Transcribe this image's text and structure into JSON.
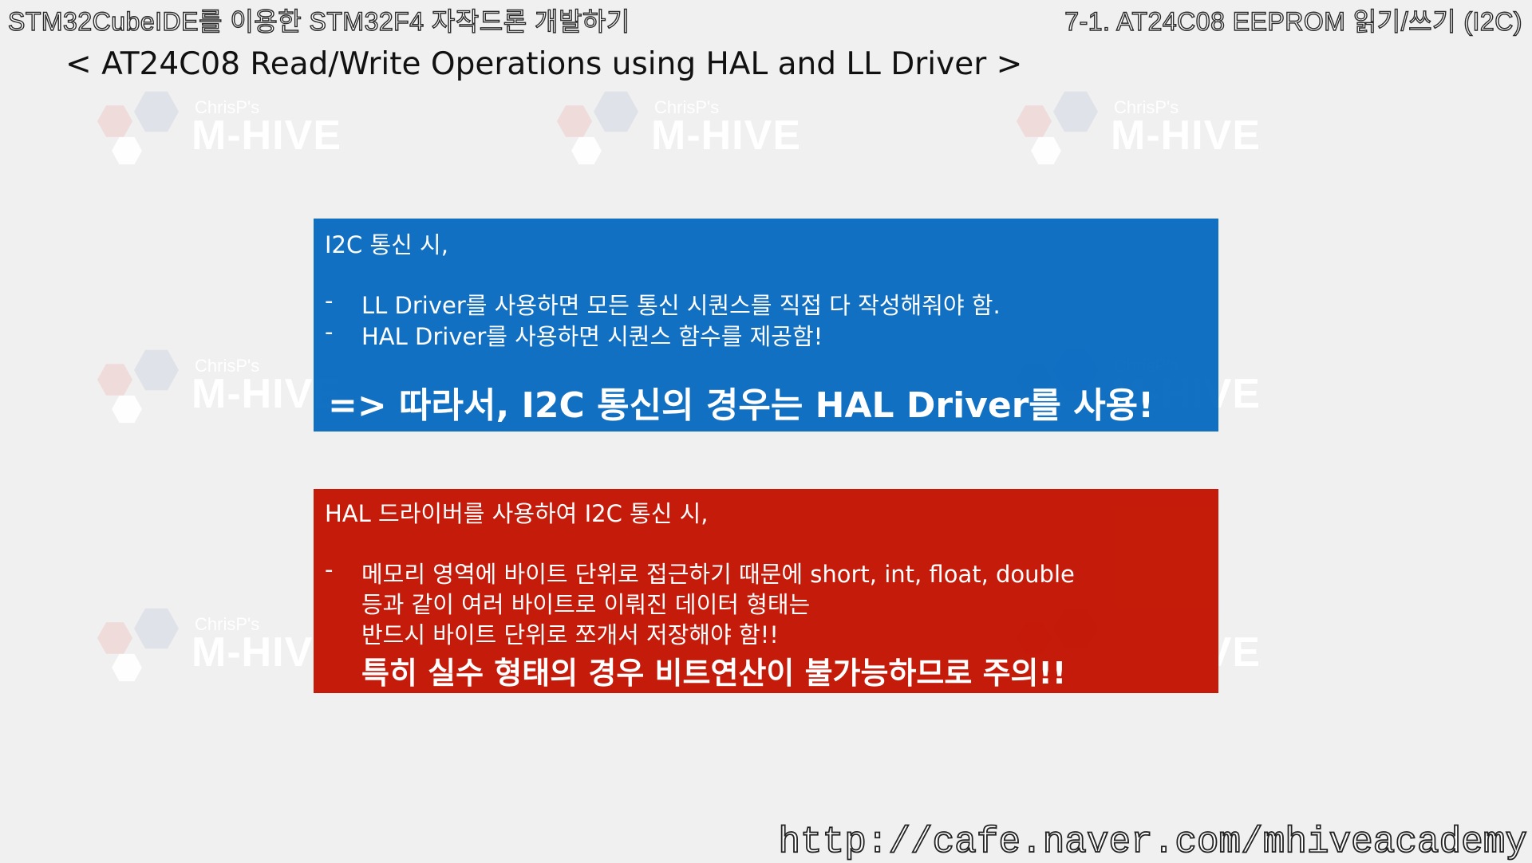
{
  "header": {
    "left_title": "STM32CubeIDE를 이용한 STM32F4 자작드론 개발하기",
    "right_title": "7-1. AT24C08 EEPROM 읽기/쓰기 (I2C)"
  },
  "subtitle": "< AT24C08 Read/Write Operations using HAL and LL Driver >",
  "watermark": {
    "small": "ChrisP's",
    "big": "M-HIVE"
  },
  "blue_box": {
    "heading": "I2C 통신 시,",
    "bullet_mark": "-",
    "bullets": [
      "LL Driver를 사용하면 모든 통신 시퀀스를 직접 다 작성해줘야 함.",
      "HAL Driver를 사용하면 시퀀스 함수를 제공함!"
    ],
    "conclusion": "=> 따라서, I2C 통신의 경우는 HAL Driver를 사용!"
  },
  "red_box": {
    "heading": "HAL 드라이버를 사용하여 I2C 통신 시,",
    "bullet_mark": "-",
    "bullet_lines": [
      "메모리 영역에 바이트 단위로 접근하기 때문에 short, int, float, double",
      "등과 같이 여러 바이트로 이뤄진 데이터 형태는",
      "반드시 바이트 단위로 쪼개서 저장해야 함!!"
    ],
    "warning": "특히 실수 형태의 경우 비트연산이 불가능하므로 주의!!"
  },
  "footer": {
    "url": "http://cafe.naver.com/mhiveacademy"
  },
  "colors": {
    "blue_box": "#0066be",
    "red_box": "#c31200",
    "background": "#f0f0f0"
  }
}
